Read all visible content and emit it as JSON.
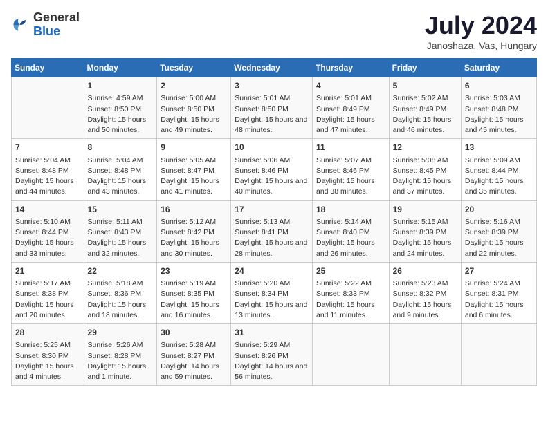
{
  "logo": {
    "general": "General",
    "blue": "Blue"
  },
  "header": {
    "month": "July 2024",
    "location": "Janoshaza, Vas, Hungary"
  },
  "days_of_week": [
    "Sunday",
    "Monday",
    "Tuesday",
    "Wednesday",
    "Thursday",
    "Friday",
    "Saturday"
  ],
  "weeks": [
    [
      {
        "day": "",
        "info": ""
      },
      {
        "day": "1",
        "info": "Sunrise: 4:59 AM\nSunset: 8:50 PM\nDaylight: 15 hours and 50 minutes."
      },
      {
        "day": "2",
        "info": "Sunrise: 5:00 AM\nSunset: 8:50 PM\nDaylight: 15 hours and 49 minutes."
      },
      {
        "day": "3",
        "info": "Sunrise: 5:01 AM\nSunset: 8:50 PM\nDaylight: 15 hours and 48 minutes."
      },
      {
        "day": "4",
        "info": "Sunrise: 5:01 AM\nSunset: 8:49 PM\nDaylight: 15 hours and 47 minutes."
      },
      {
        "day": "5",
        "info": "Sunrise: 5:02 AM\nSunset: 8:49 PM\nDaylight: 15 hours and 46 minutes."
      },
      {
        "day": "6",
        "info": "Sunrise: 5:03 AM\nSunset: 8:48 PM\nDaylight: 15 hours and 45 minutes."
      }
    ],
    [
      {
        "day": "7",
        "info": "Sunrise: 5:04 AM\nSunset: 8:48 PM\nDaylight: 15 hours and 44 minutes."
      },
      {
        "day": "8",
        "info": "Sunrise: 5:04 AM\nSunset: 8:48 PM\nDaylight: 15 hours and 43 minutes."
      },
      {
        "day": "9",
        "info": "Sunrise: 5:05 AM\nSunset: 8:47 PM\nDaylight: 15 hours and 41 minutes."
      },
      {
        "day": "10",
        "info": "Sunrise: 5:06 AM\nSunset: 8:46 PM\nDaylight: 15 hours and 40 minutes."
      },
      {
        "day": "11",
        "info": "Sunrise: 5:07 AM\nSunset: 8:46 PM\nDaylight: 15 hours and 38 minutes."
      },
      {
        "day": "12",
        "info": "Sunrise: 5:08 AM\nSunset: 8:45 PM\nDaylight: 15 hours and 37 minutes."
      },
      {
        "day": "13",
        "info": "Sunrise: 5:09 AM\nSunset: 8:44 PM\nDaylight: 15 hours and 35 minutes."
      }
    ],
    [
      {
        "day": "14",
        "info": "Sunrise: 5:10 AM\nSunset: 8:44 PM\nDaylight: 15 hours and 33 minutes."
      },
      {
        "day": "15",
        "info": "Sunrise: 5:11 AM\nSunset: 8:43 PM\nDaylight: 15 hours and 32 minutes."
      },
      {
        "day": "16",
        "info": "Sunrise: 5:12 AM\nSunset: 8:42 PM\nDaylight: 15 hours and 30 minutes."
      },
      {
        "day": "17",
        "info": "Sunrise: 5:13 AM\nSunset: 8:41 PM\nDaylight: 15 hours and 28 minutes."
      },
      {
        "day": "18",
        "info": "Sunrise: 5:14 AM\nSunset: 8:40 PM\nDaylight: 15 hours and 26 minutes."
      },
      {
        "day": "19",
        "info": "Sunrise: 5:15 AM\nSunset: 8:39 PM\nDaylight: 15 hours and 24 minutes."
      },
      {
        "day": "20",
        "info": "Sunrise: 5:16 AM\nSunset: 8:39 PM\nDaylight: 15 hours and 22 minutes."
      }
    ],
    [
      {
        "day": "21",
        "info": "Sunrise: 5:17 AM\nSunset: 8:38 PM\nDaylight: 15 hours and 20 minutes."
      },
      {
        "day": "22",
        "info": "Sunrise: 5:18 AM\nSunset: 8:36 PM\nDaylight: 15 hours and 18 minutes."
      },
      {
        "day": "23",
        "info": "Sunrise: 5:19 AM\nSunset: 8:35 PM\nDaylight: 15 hours and 16 minutes."
      },
      {
        "day": "24",
        "info": "Sunrise: 5:20 AM\nSunset: 8:34 PM\nDaylight: 15 hours and 13 minutes."
      },
      {
        "day": "25",
        "info": "Sunrise: 5:22 AM\nSunset: 8:33 PM\nDaylight: 15 hours and 11 minutes."
      },
      {
        "day": "26",
        "info": "Sunrise: 5:23 AM\nSunset: 8:32 PM\nDaylight: 15 hours and 9 minutes."
      },
      {
        "day": "27",
        "info": "Sunrise: 5:24 AM\nSunset: 8:31 PM\nDaylight: 15 hours and 6 minutes."
      }
    ],
    [
      {
        "day": "28",
        "info": "Sunrise: 5:25 AM\nSunset: 8:30 PM\nDaylight: 15 hours and 4 minutes."
      },
      {
        "day": "29",
        "info": "Sunrise: 5:26 AM\nSunset: 8:28 PM\nDaylight: 15 hours and 1 minute."
      },
      {
        "day": "30",
        "info": "Sunrise: 5:28 AM\nSunset: 8:27 PM\nDaylight: 14 hours and 59 minutes."
      },
      {
        "day": "31",
        "info": "Sunrise: 5:29 AM\nSunset: 8:26 PM\nDaylight: 14 hours and 56 minutes."
      },
      {
        "day": "",
        "info": ""
      },
      {
        "day": "",
        "info": ""
      },
      {
        "day": "",
        "info": ""
      }
    ]
  ]
}
